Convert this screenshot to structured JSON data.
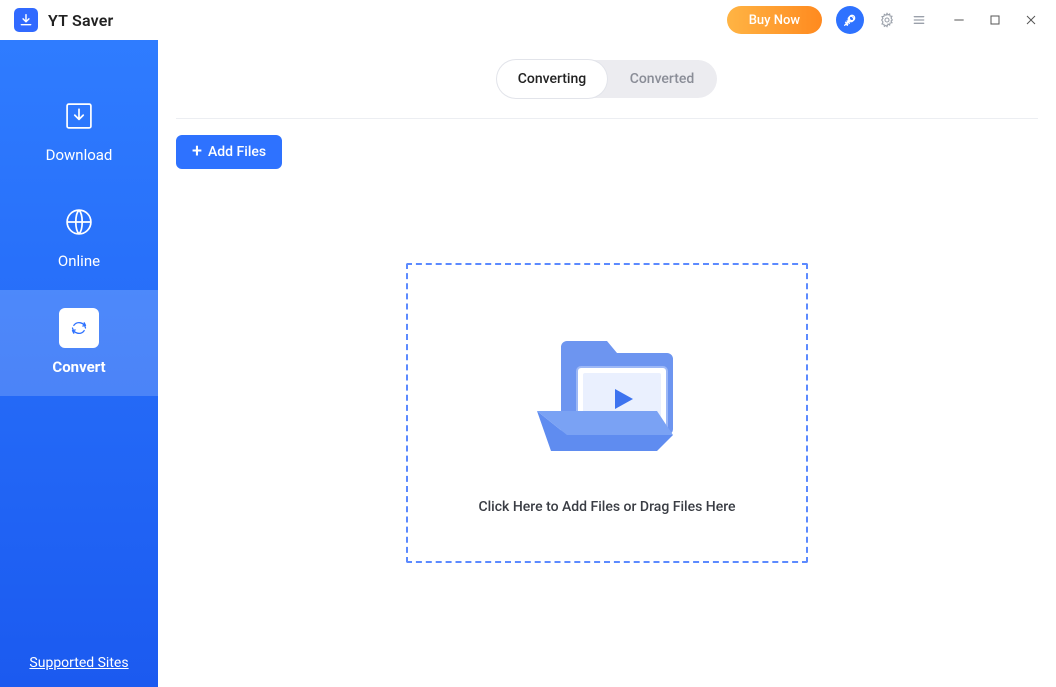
{
  "app": {
    "title": "YT Saver"
  },
  "titlebar": {
    "buy": "Buy Now"
  },
  "sidebar": {
    "items": [
      {
        "label": "Download"
      },
      {
        "label": "Online"
      },
      {
        "label": "Convert"
      }
    ],
    "supported": "Supported Sites"
  },
  "tabs": {
    "converting": "Converting",
    "converted": "Converted"
  },
  "toolbar": {
    "add_files": "Add Files"
  },
  "dropzone": {
    "text": "Click Here to Add Files or Drag Files Here"
  }
}
